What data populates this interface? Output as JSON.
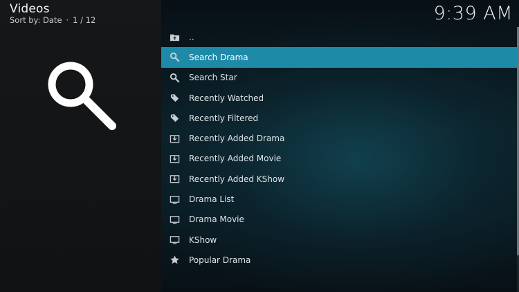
{
  "header": {
    "title": "Videos",
    "sort_label": "Sort by: Date",
    "separator": "·",
    "position": "1 / 12"
  },
  "clock": "9:39 AM",
  "preview_icon": "search-icon",
  "list": {
    "items": [
      {
        "label": "..",
        "icon": "parent-folder-icon",
        "selected": false
      },
      {
        "label": "Search Drama",
        "icon": "search-icon",
        "selected": true
      },
      {
        "label": "Search Star",
        "icon": "search-icon",
        "selected": false
      },
      {
        "label": "Recently Watched",
        "icon": "tag-icon",
        "selected": false
      },
      {
        "label": "Recently Filtered",
        "icon": "tag-icon",
        "selected": false
      },
      {
        "label": "Recently Added Drama",
        "icon": "download-icon",
        "selected": false
      },
      {
        "label": "Recently Added Movie",
        "icon": "download-icon",
        "selected": false
      },
      {
        "label": "Recently Added KShow",
        "icon": "download-icon",
        "selected": false
      },
      {
        "label": "Drama List",
        "icon": "tv-icon",
        "selected": false
      },
      {
        "label": "Drama Movie",
        "icon": "tv-icon",
        "selected": false
      },
      {
        "label": "KShow",
        "icon": "tv-icon",
        "selected": false
      },
      {
        "label": "Popular Drama",
        "icon": "star-icon",
        "selected": false
      }
    ]
  },
  "colors": {
    "selection": "#1d8aa8",
    "text": "#dfe4e7"
  }
}
